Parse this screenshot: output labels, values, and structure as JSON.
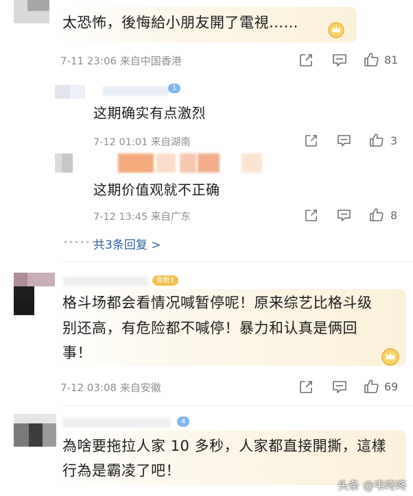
{
  "comments": [
    {
      "text": "太恐怖，後悔給小朋友開了電視……",
      "meta": "7-11 23:06  来自中国香港",
      "likes": "81"
    },
    {
      "text_line1": "格斗场都会看情况喊暂停呢！原来综艺比格斗级",
      "text_line2": "别还高，有危险都不喊停！暴力和认真是俩回",
      "text_line3": "事！",
      "badge": "金粉1",
      "meta": "7-12 03:08  来自安徽",
      "likes": "69"
    },
    {
      "text_line1": "為啥要拖拉人家 10 多秒，人家都直接開撕，這樣",
      "text_line2": "行為是霸凌了吧！",
      "badge": "4"
    }
  ],
  "replies": [
    {
      "text": "这期确实有点激烈",
      "badge": "1",
      "meta": "7-12 01:01  来自湖南",
      "likes": "3"
    },
    {
      "text": "这期价值观就不正确",
      "meta": "7-12 13:45  来自广东",
      "likes": "8"
    }
  ],
  "more_replies": "共3条回复 >",
  "watermark": "头条 @韦咚咚",
  "colors": {
    "meta": "#8e8e8e",
    "link": "#2f5f9e",
    "badge": "#f5c04a",
    "badge_blue": "#4aa3f0"
  }
}
